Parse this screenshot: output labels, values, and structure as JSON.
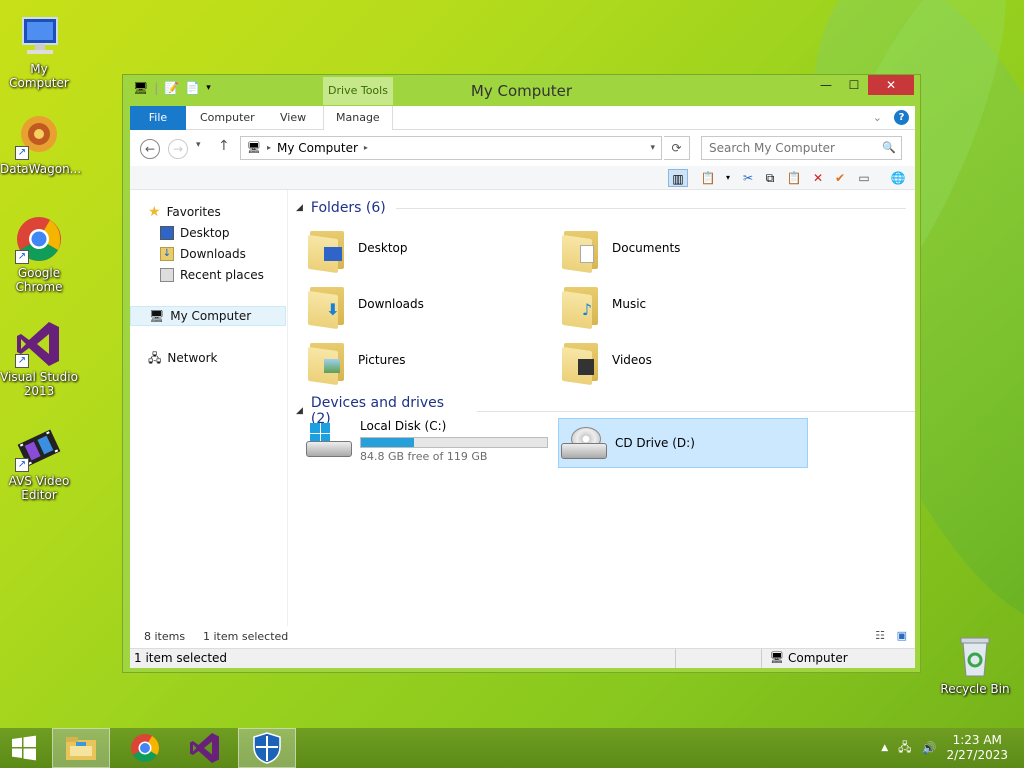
{
  "desktop": {
    "icons": [
      {
        "label": "My Computer"
      },
      {
        "label": "DataWagon..."
      },
      {
        "label": "Google Chrome"
      },
      {
        "label": "Visual Studio 2013"
      },
      {
        "label": "AVS Video Editor"
      },
      {
        "label": "Recycle Bin"
      }
    ]
  },
  "window": {
    "title": "My Computer",
    "contextual_tab": "Drive Tools",
    "controls": {
      "minimize": "—",
      "maximize": "☐",
      "close": "✕"
    },
    "ribbon_tabs": [
      "File",
      "Computer",
      "View",
      "Manage"
    ],
    "help": "?",
    "address": {
      "location": "My Computer"
    },
    "search": {
      "placeholder": "Search My Computer"
    },
    "nav_pane": {
      "favorites": "Favorites",
      "favorite_items": [
        "Desktop",
        "Downloads",
        "Recent places"
      ],
      "computer": "My Computer",
      "network": "Network"
    },
    "folders_group": "Folders (6)",
    "folders": [
      "Desktop",
      "Documents",
      "Downloads",
      "Music",
      "Pictures",
      "Videos"
    ],
    "drives_group": "Devices and drives (2)",
    "drives": [
      {
        "name": "Local Disk (C:)",
        "free_text": "84.8 GB free of 119 GB",
        "used_fraction": 0.287
      },
      {
        "name": "CD Drive (D:)",
        "selected": true
      }
    ],
    "status": {
      "items": "8 items",
      "selected": "1 item selected"
    },
    "bottom_status": {
      "left": "1 item selected",
      "right": "Computer"
    }
  },
  "taskbar": {
    "time": "1:23 AM",
    "date": "2/27/2023"
  },
  "colors": {
    "accent": "#1979ca",
    "close": "#c8383a",
    "selection": "#cce8ff",
    "progress": "#26a0da"
  }
}
